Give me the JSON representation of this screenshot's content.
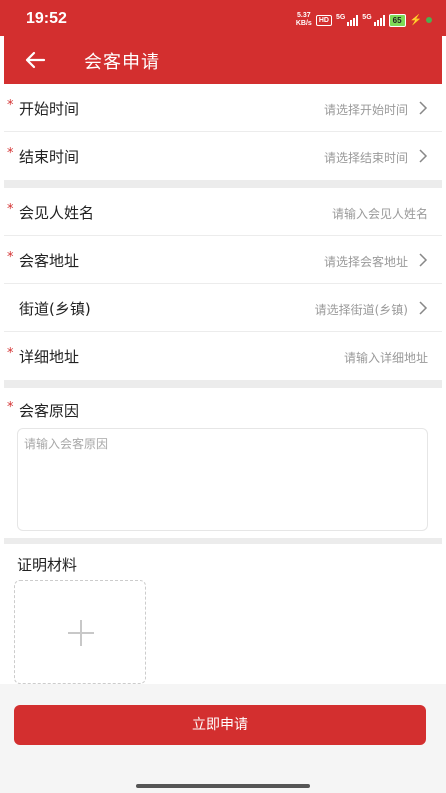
{
  "status_bar": {
    "time": "19:52",
    "net_speed_top": "5.37",
    "net_speed_bottom": "KB/s",
    "hd": "HD",
    "sig1": "5G",
    "sig2": "5G",
    "battery": "65"
  },
  "appbar": {
    "title": "会客申请"
  },
  "form": {
    "start_time": {
      "label": "开始时间",
      "placeholder": "请选择开始时间",
      "required_mark": "*"
    },
    "end_time": {
      "label": "结束时间",
      "placeholder": "请选择结束时间",
      "required_mark": "*"
    },
    "visitor_name": {
      "label": "会见人姓名",
      "placeholder": "请输入会见人姓名",
      "required_mark": "*"
    },
    "visit_address": {
      "label": "会客地址",
      "placeholder": "请选择会客地址",
      "required_mark": "*"
    },
    "street": {
      "label": "街道(乡镇)",
      "placeholder": "请选择街道(乡镇)"
    },
    "detail_address": {
      "label": "详细地址",
      "placeholder": "请输入详细地址",
      "required_mark": "*"
    },
    "reason": {
      "label": "会客原因",
      "placeholder": "请输入会客原因",
      "required_mark": "*"
    },
    "proof": {
      "label": "证明材料"
    }
  },
  "submit": {
    "label": "立即申请"
  },
  "colors": {
    "brand": "#d32f2f",
    "divider": "#ececec",
    "placeholder": "#9a9a9a"
  }
}
